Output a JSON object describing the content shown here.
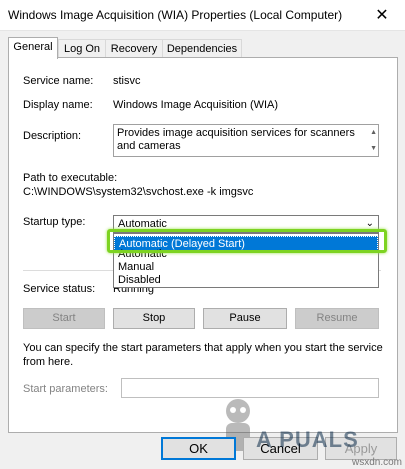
{
  "window": {
    "title": "Windows Image Acquisition (WIA) Properties (Local Computer)",
    "close_glyph": "✕"
  },
  "tabs": [
    {
      "label": "General"
    },
    {
      "label": "Log On"
    },
    {
      "label": "Recovery"
    },
    {
      "label": "Dependencies"
    }
  ],
  "fields": {
    "service_name_label": "Service name:",
    "service_name_value": "stisvc",
    "display_name_label": "Display name:",
    "display_name_value": "Windows Image Acquisition (WIA)",
    "description_label": "Description:",
    "description_value": "Provides image acquisition services for scanners and cameras",
    "path_label": "Path to executable:",
    "path_value": "C:\\WINDOWS\\system32\\svchost.exe -k imgsvc",
    "startup_type_label": "Startup type:",
    "startup_type_value": "Automatic",
    "service_status_label": "Service status:",
    "service_status_value": "Running",
    "hint_text": "You can specify the start parameters that apply when you start the service from here.",
    "start_params_label": "Start parameters:",
    "start_params_value": ""
  },
  "dropdown_options": [
    {
      "label": "Automatic (Delayed Start)",
      "highlighted": true
    },
    {
      "label": "Automatic",
      "highlighted": false
    },
    {
      "label": "Manual",
      "highlighted": false
    },
    {
      "label": "Disabled",
      "highlighted": false
    }
  ],
  "buttons": {
    "start": "Start",
    "stop": "Stop",
    "pause": "Pause",
    "resume": "Resume"
  },
  "footer": {
    "ok": "OK",
    "cancel": "Cancel",
    "apply": "Apply"
  },
  "branding": {
    "appuals": "A PUALS",
    "watermark": "wsxdn.com"
  },
  "colors": {
    "highlight": "#0078d7",
    "callout": "#7dd321"
  }
}
